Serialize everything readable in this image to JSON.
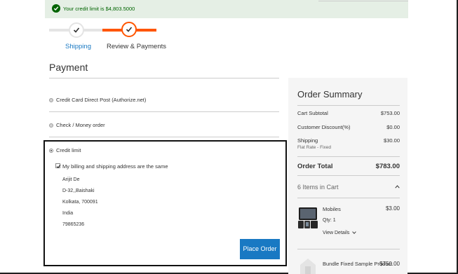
{
  "alert": {
    "message": "Your credit limit is $4,803.5000",
    "icon": "check-circle-icon",
    "color": "#006400",
    "background": "#e5efe5"
  },
  "progress": {
    "steps": [
      {
        "label": "Shipping",
        "state": "complete",
        "color": "#1979c3"
      },
      {
        "label": "Review & Payments",
        "state": "active",
        "color": "#ff5501"
      }
    ]
  },
  "payment": {
    "title": "Payment",
    "methods": [
      {
        "label": "Credit Card Direct Post (Authorize.net)",
        "selected": false
      },
      {
        "label": "Check / Money order",
        "selected": false
      },
      {
        "label": "Credit limit",
        "selected": true
      }
    ],
    "same_address_label": "My billing and shipping address are the same",
    "same_address_checked": true,
    "address": [
      "Arijit De",
      "D-32,,Baishaki",
      "Kolkata, 700091",
      "India",
      "79865236"
    ],
    "place_order_label": "Place Order"
  },
  "summary": {
    "title": "Order Summary",
    "rows": [
      {
        "label": "Cart Subtotal",
        "value": "$753.00"
      },
      {
        "label": "Customer Discount(%)",
        "value": "$0.00"
      },
      {
        "label": "Shipping",
        "value": "$30.00"
      }
    ],
    "shipping_method": "Flat Rate - Fixed",
    "total_label": "Order Total",
    "total_value": "$783.00",
    "items_label": "6 Items in Cart",
    "items": [
      {
        "name": "Mobiles",
        "price": "$3.00",
        "qty": "Qty: 1",
        "details_label": "View Details"
      },
      {
        "name": "Bundle Fixed Sample Product",
        "price": "$750.00"
      }
    ]
  },
  "colors": {
    "accent": "#1979c3",
    "active_step": "#ff5501",
    "sidebar_bg": "#f5f5f5"
  }
}
